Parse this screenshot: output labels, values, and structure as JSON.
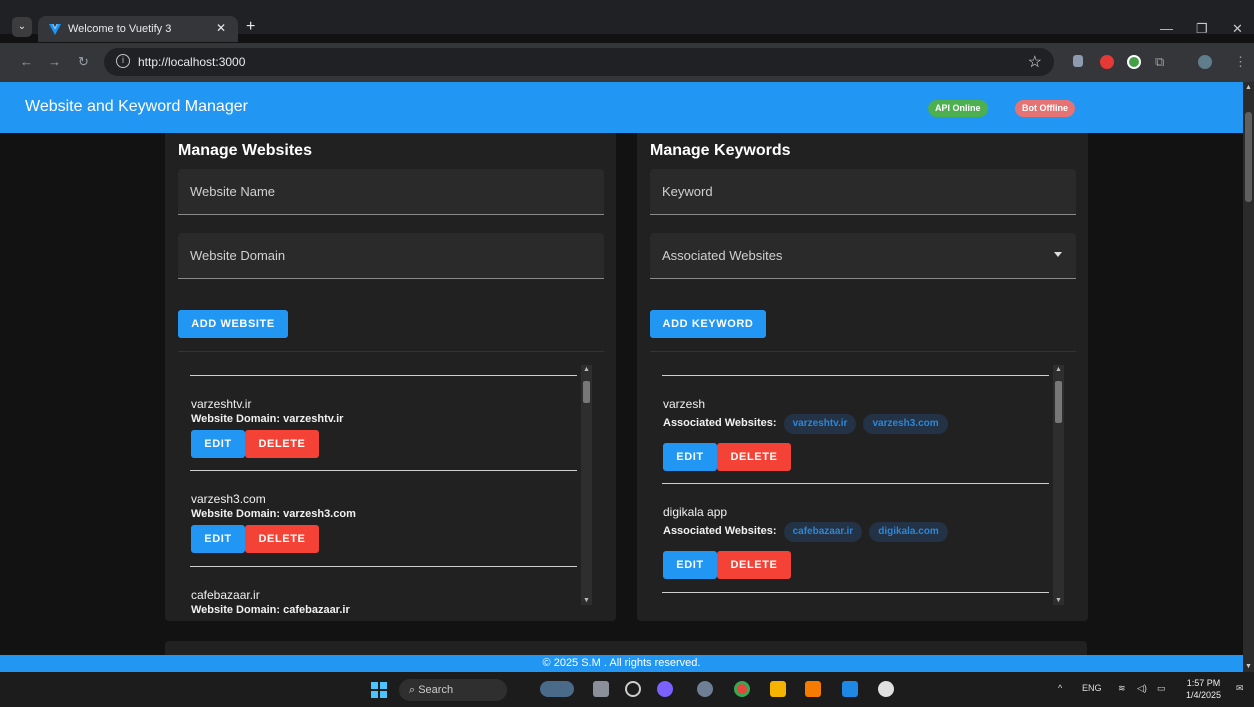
{
  "browser": {
    "tab_title": "Welcome to Vuetify 3",
    "url": "http://localhost:3000",
    "new_tab_label": "+"
  },
  "app": {
    "title": "Website and Keyword Manager",
    "api_status": "API Online",
    "bot_status": "Bot Offline",
    "colors": {
      "primary": "#2196f3",
      "danger": "#f44336",
      "success": "#4caf50",
      "bot_offline": "#e57373"
    }
  },
  "websites": {
    "title": "Manage Websites",
    "name_placeholder": "Website Name",
    "domain_placeholder": "Website Domain",
    "add_label": "ADD WEBSITE",
    "domain_prefix": "Website Domain:",
    "edit_label": "EDIT",
    "delete_label": "DELETE",
    "items": [
      {
        "name": "varzeshtv.ir",
        "domain": "varzeshtv.ir"
      },
      {
        "name": "varzesh3.com",
        "domain": "varzesh3.com"
      },
      {
        "name": "cafebazaar.ir",
        "domain": "cafebazaar.ir"
      }
    ]
  },
  "keywords": {
    "title": "Manage Keywords",
    "keyword_placeholder": "Keyword",
    "websites_placeholder": "Associated Websites",
    "add_label": "ADD KEYWORD",
    "assoc_prefix": "Associated Websites:",
    "edit_label": "EDIT",
    "delete_label": "DELETE",
    "items": [
      {
        "name": "varzesh",
        "sites": [
          "varzeshtv.ir",
          "varzesh3.com"
        ]
      },
      {
        "name": "digikala app",
        "sites": [
          "cafebazaar.ir",
          "digikala.com"
        ]
      }
    ]
  },
  "footer": {
    "text": "© 2025 S.M . All rights reserved."
  },
  "taskbar": {
    "search_label": "Search",
    "lang": "ENG",
    "time": "1:57 PM",
    "date": "1/4/2025"
  }
}
